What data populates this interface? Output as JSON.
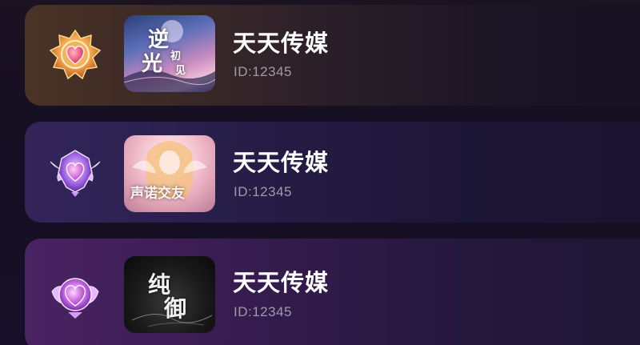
{
  "list": {
    "items": [
      {
        "badge_icon": "gold-heart-badge-icon",
        "cover_text": [
          "逆",
          "光",
          "初",
          "见"
        ],
        "title": "天天传媒",
        "subtitle": "ID:12345"
      },
      {
        "badge_icon": "purple-winged-heart-badge-icon",
        "cover_text": [
          "声诺交友"
        ],
        "title": "天天传媒",
        "subtitle": "ID:12345"
      },
      {
        "badge_icon": "violet-heart-badge-icon",
        "cover_text": [
          "纯",
          "御"
        ],
        "title": "天天传媒",
        "subtitle": "ID:12345"
      }
    ]
  },
  "colors": {
    "card_1_tint": "#4a3326",
    "card_2_tint": "#33255a",
    "card_3_tint": "#4a2362",
    "title": "#ffffff",
    "subtitle": "#a19aa8"
  }
}
